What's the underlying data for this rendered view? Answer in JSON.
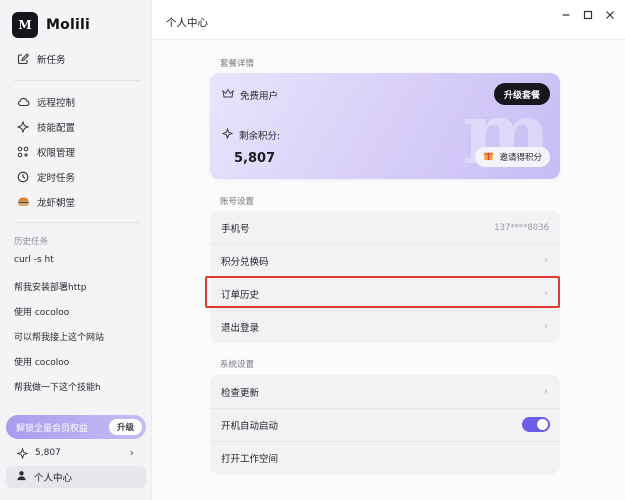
{
  "brand": {
    "name": "Molili",
    "logo_letter": "M"
  },
  "sidebar": {
    "new_task": "新任务",
    "items": [
      {
        "label": "远程控制",
        "icon": "cloud-icon"
      },
      {
        "label": "技能配置",
        "icon": "wand-icon"
      },
      {
        "label": "权限管理",
        "icon": "grid-icon"
      },
      {
        "label": "定时任务",
        "icon": "clock-icon"
      },
      {
        "label": "龙虾朝堂",
        "icon": "burger-icon"
      }
    ],
    "history_title": "历史任务",
    "history": [
      "curl -s ht",
      "帮我安装部署http",
      "使用 cocoloo",
      "可以帮我接上这个网站",
      "使用 cocoloo",
      "帮我做一下这个技能h"
    ],
    "upgrade_banner": "解锁全量会员权益",
    "upgrade_button": "升级",
    "points": "5,807",
    "profile": "个人中心"
  },
  "header": {
    "title": "个人中心"
  },
  "plan": {
    "section_title": "套餐详情",
    "user_type": "免费用户",
    "upgrade_button": "升级套餐",
    "points_label": "剩余积分:",
    "points_value": "5,807",
    "invite_button": "邀请得积分"
  },
  "account": {
    "section_title": "账号设置",
    "phone_label": "手机号",
    "phone_value": "137****8036",
    "redeem_label": "积分兑换码",
    "orders_label": "订单历史",
    "logout_label": "退出登录"
  },
  "system": {
    "section_title": "系统设置",
    "check_update_label": "检查更新",
    "autostart_label": "开机自动启动",
    "autostart_enabled": true,
    "open_workspace_label": "打开工作空间"
  },
  "colors": {
    "accent": "#6c5ce7",
    "highlight": "#e0392f"
  }
}
